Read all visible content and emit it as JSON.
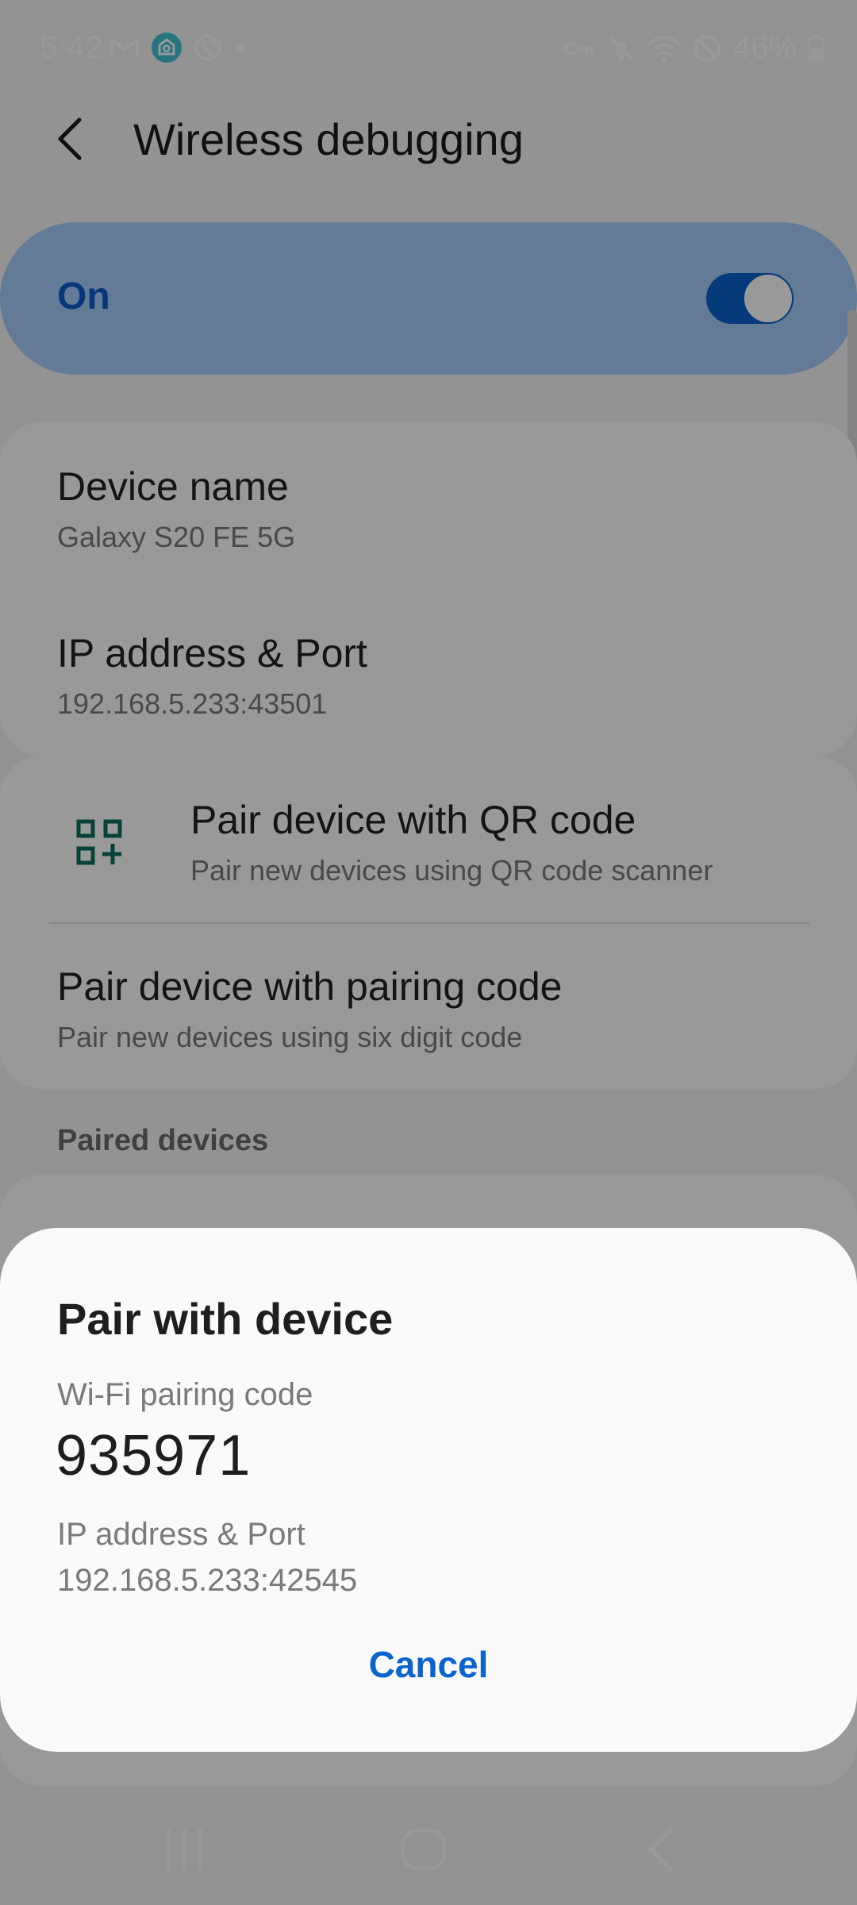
{
  "status_bar": {
    "time": "5:42",
    "battery": "46%",
    "icons": [
      "gmail-icon",
      "smartthings-icon",
      "globe-icon",
      "notification-dot-icon",
      "vpn-key-icon",
      "mute-icon",
      "wifi-icon",
      "do-not-disturb-icon",
      "battery-icon"
    ]
  },
  "header": {
    "title": "Wireless debugging",
    "back_icon": "chevron-left-icon"
  },
  "master_switch": {
    "label": "On",
    "state": "on"
  },
  "info": {
    "device_name_title": "Device name",
    "device_name_value": "Galaxy S20 FE 5G",
    "ip_title": "IP address & Port",
    "ip_value": "192.168.5.233:43501"
  },
  "pair_options": {
    "qr_title": "Pair device with QR code",
    "qr_subtitle": "Pair new devices using QR code scanner",
    "code_title": "Pair device with pairing code",
    "code_subtitle": "Pair new devices using six digit code"
  },
  "paired_devices": {
    "section_label": "Paired devices"
  },
  "dialog": {
    "title": "Pair with device",
    "code_label": "Wi-Fi pairing code",
    "code_value": "935971",
    "ip_label": "IP address & Port",
    "ip_value": "192.168.5.233:42545",
    "cancel_label": "Cancel"
  },
  "nav_bar": {
    "icons": [
      "recent-apps-icon",
      "home-icon",
      "back-icon"
    ]
  },
  "colors": {
    "accent": "#0b63ce",
    "switch_bg": "#a6cdfa",
    "qr_icon": "#0a6e5c"
  }
}
